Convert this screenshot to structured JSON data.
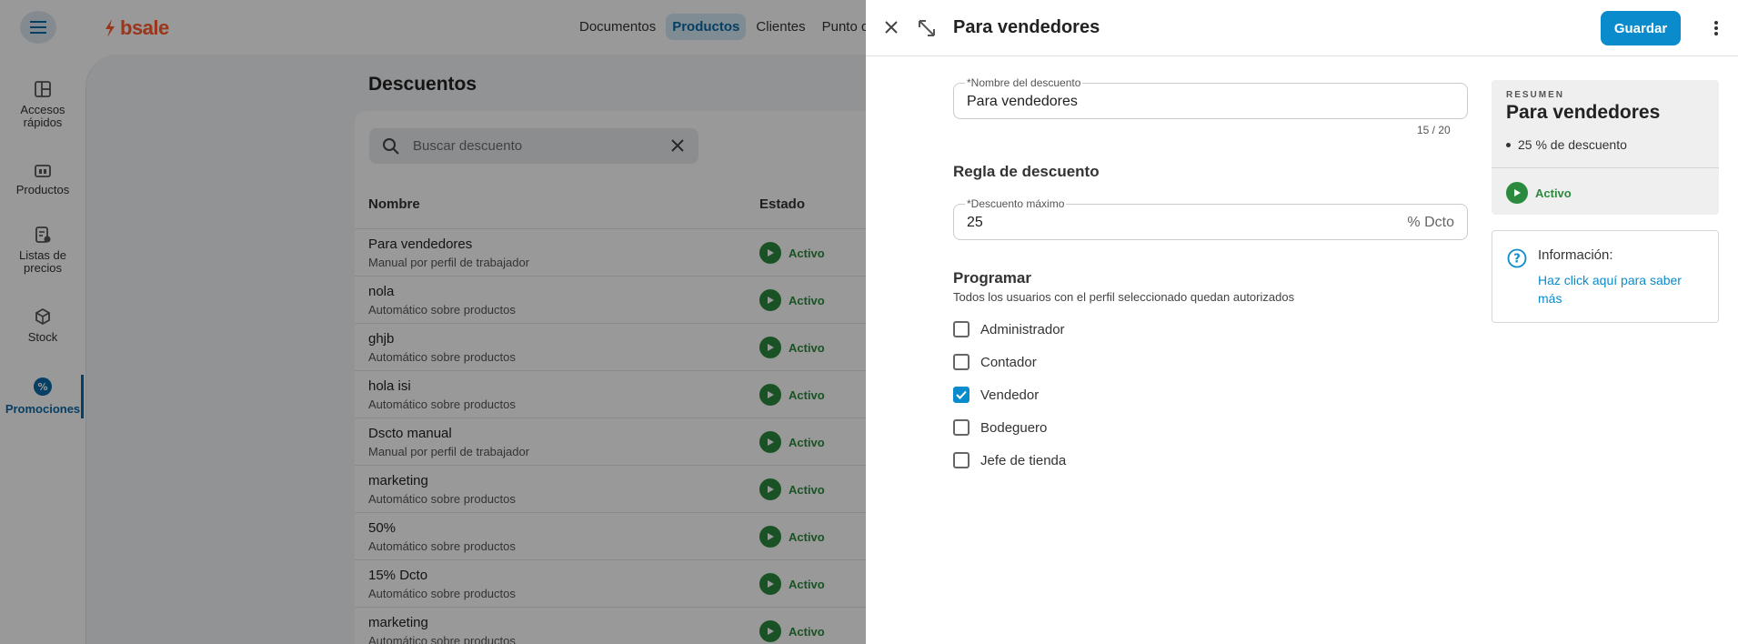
{
  "app": {
    "logo_text": "bsale",
    "nav": [
      "Documentos",
      "Productos",
      "Clientes",
      "Punto de"
    ],
    "nav_active": "Productos"
  },
  "sidebar": {
    "items": [
      {
        "label": "Accesos rápidos"
      },
      {
        "label": "Productos"
      },
      {
        "label": "Listas de precios"
      },
      {
        "label": "Stock"
      },
      {
        "label": "Promociones"
      }
    ]
  },
  "page": {
    "title": "Descuentos",
    "search_placeholder": "Buscar descuento",
    "columns": {
      "name": "Nombre",
      "status": "Estado"
    },
    "rows": [
      {
        "name": "Para vendedores",
        "desc": "Manual por perfil de trabajador",
        "status": "Activo"
      },
      {
        "name": "nola",
        "desc": "Automático sobre productos",
        "status": "Activo"
      },
      {
        "name": "ghjb",
        "desc": "Automático sobre productos",
        "status": "Activo"
      },
      {
        "name": "hola isi",
        "desc": "Automático sobre productos",
        "status": "Activo"
      },
      {
        "name": "Dscto manual",
        "desc": "Manual por perfil de trabajador",
        "status": "Activo"
      },
      {
        "name": "marketing",
        "desc": "Automático sobre productos",
        "status": "Activo"
      },
      {
        "name": "50%",
        "desc": "Automático sobre productos",
        "status": "Activo"
      },
      {
        "name": "15% Dcto",
        "desc": "Automático sobre productos",
        "status": "Activo"
      },
      {
        "name": "marketing",
        "desc": "Automático sobre productos",
        "status": "Activo"
      }
    ]
  },
  "drawer": {
    "title": "Para vendedores",
    "save_label": "Guardar",
    "name_field": {
      "label": "*Nombre del descuento",
      "value": "Para vendedores",
      "counter": "15 / 20"
    },
    "rule_title": "Regla de descuento",
    "max_field": {
      "label": "*Descuento máximo",
      "value": "25",
      "suffix": "% Dcto"
    },
    "schedule_title": "Programar",
    "schedule_sub": "Todos los usuarios con el perfil seleccionado quedan autorizados",
    "profiles": [
      {
        "label": "Administrador",
        "checked": false
      },
      {
        "label": "Contador",
        "checked": false
      },
      {
        "label": "Vendedor",
        "checked": true
      },
      {
        "label": "Bodeguero",
        "checked": false
      },
      {
        "label": "Jefe de tienda",
        "checked": false
      }
    ],
    "summary": {
      "kicker": "RESUMEN",
      "title": "Para vendedores",
      "bullet": "25 % de descuento",
      "status": "Activo"
    },
    "info": {
      "title": "Información:",
      "link": "Haz click aquí para saber más"
    }
  },
  "colors": {
    "accent": "#0a8ccc",
    "active_green": "#2b8a3e",
    "brand": "#ff5a2d"
  }
}
